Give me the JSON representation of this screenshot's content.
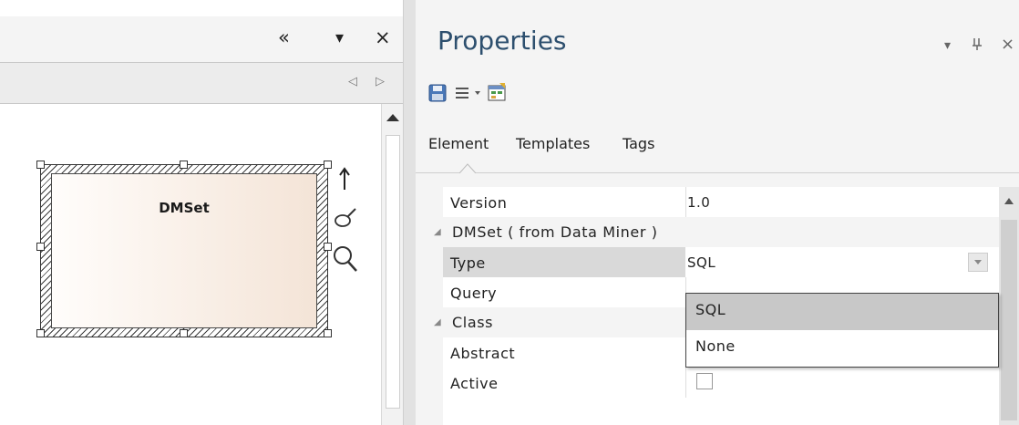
{
  "diagram": {
    "element_name": "DMSet",
    "header_buttons": {
      "collapse_glyph": "«",
      "menu_glyph": "▾",
      "close_glyph": "×"
    },
    "nav_buttons": {
      "prev_glyph": "◁",
      "next_glyph": "▷"
    }
  },
  "properties": {
    "title": "Properties",
    "window_controls": {
      "menu_glyph": "▾",
      "pin_glyph": "ᵽ",
      "close_glyph": "×"
    },
    "tabs": [
      {
        "label": "Element"
      },
      {
        "label": "Templates"
      },
      {
        "label": "Tags"
      }
    ],
    "active_tab": "Element",
    "rows": {
      "version": {
        "name": "Version",
        "value": "1.0"
      },
      "group_dmset": {
        "label": "DMSet ( from Data Miner )"
      },
      "type": {
        "name": "Type",
        "value": "SQL"
      },
      "query": {
        "name": "Query",
        "value": ""
      },
      "group_class": {
        "label": "Class"
      },
      "abstract": {
        "name": "Abstract",
        "checked": false
      },
      "active": {
        "name": "Active",
        "checked": false
      }
    },
    "type_dropdown": {
      "options": [
        "SQL",
        "None"
      ],
      "highlighted": "SQL"
    }
  },
  "icons": {
    "save": "save-icon",
    "menu": "hamburger-menu-icon",
    "properties": "properties-sheet-icon",
    "arrow": "up-arrow-icon",
    "brush": "format-brush-icon",
    "zoom": "magnifier-icon"
  },
  "colors": {
    "title": "#2d4f6e",
    "element_fill_start": "#fffdfb",
    "element_fill_end": "#f4e4d7",
    "selected_row": "#d9d9d9",
    "dropdown_highlight": "#c8c8c8"
  }
}
